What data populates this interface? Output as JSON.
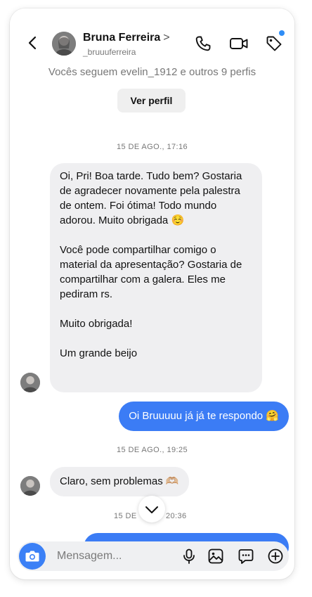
{
  "header": {
    "name": "Bruna Ferreira",
    "chevron": ">",
    "handle": "_bruuuferreira"
  },
  "follow_info": "Vocês seguem evelin_1912 e outros 9 perfis",
  "view_profile_label": "Ver perfil",
  "messages": [
    {
      "type": "timestamp",
      "text": "15 DE AGO., 17:16"
    },
    {
      "type": "incoming",
      "paragraphs": [
        "Oi, Pri! Boa tarde. Tudo bem? Gostaria de agradecer novamente pela palestra de ontem. Foi ótima! Todo mundo adorou. Muito obrigada ☺️",
        "Você pode compartilhar comigo o material da apresentação? Gostaria de compartilhar com a galera. Eles me pediram rs.",
        "Muito obrigada!",
        "Um grande beijo"
      ]
    },
    {
      "type": "outgoing",
      "text": "Oi Bruuuuu já já te respondo 🤗"
    },
    {
      "type": "timestamp",
      "text": "15 DE AGO., 19:25"
    },
    {
      "type": "incoming",
      "text": "Claro, sem problemas 🫶🏼"
    },
    {
      "type": "timestamp",
      "text_left": "15 DE",
      "text_right": "20:36"
    }
  ],
  "composer": {
    "placeholder": "Mensagem..."
  },
  "icons": {
    "back": "chevron-left-icon",
    "call": "phone-icon",
    "video": "video-camera-icon",
    "tag": "tag-icon",
    "camera": "camera-icon",
    "mic": "microphone-icon",
    "gallery": "image-icon",
    "sticker": "chat-sticker-icon",
    "add": "plus-circle-icon",
    "scroll": "chevron-down-icon"
  },
  "colors": {
    "accent": "#3b7cf5",
    "notification_dot": "#2f8df6",
    "incoming_bubble": "#efeff1"
  }
}
